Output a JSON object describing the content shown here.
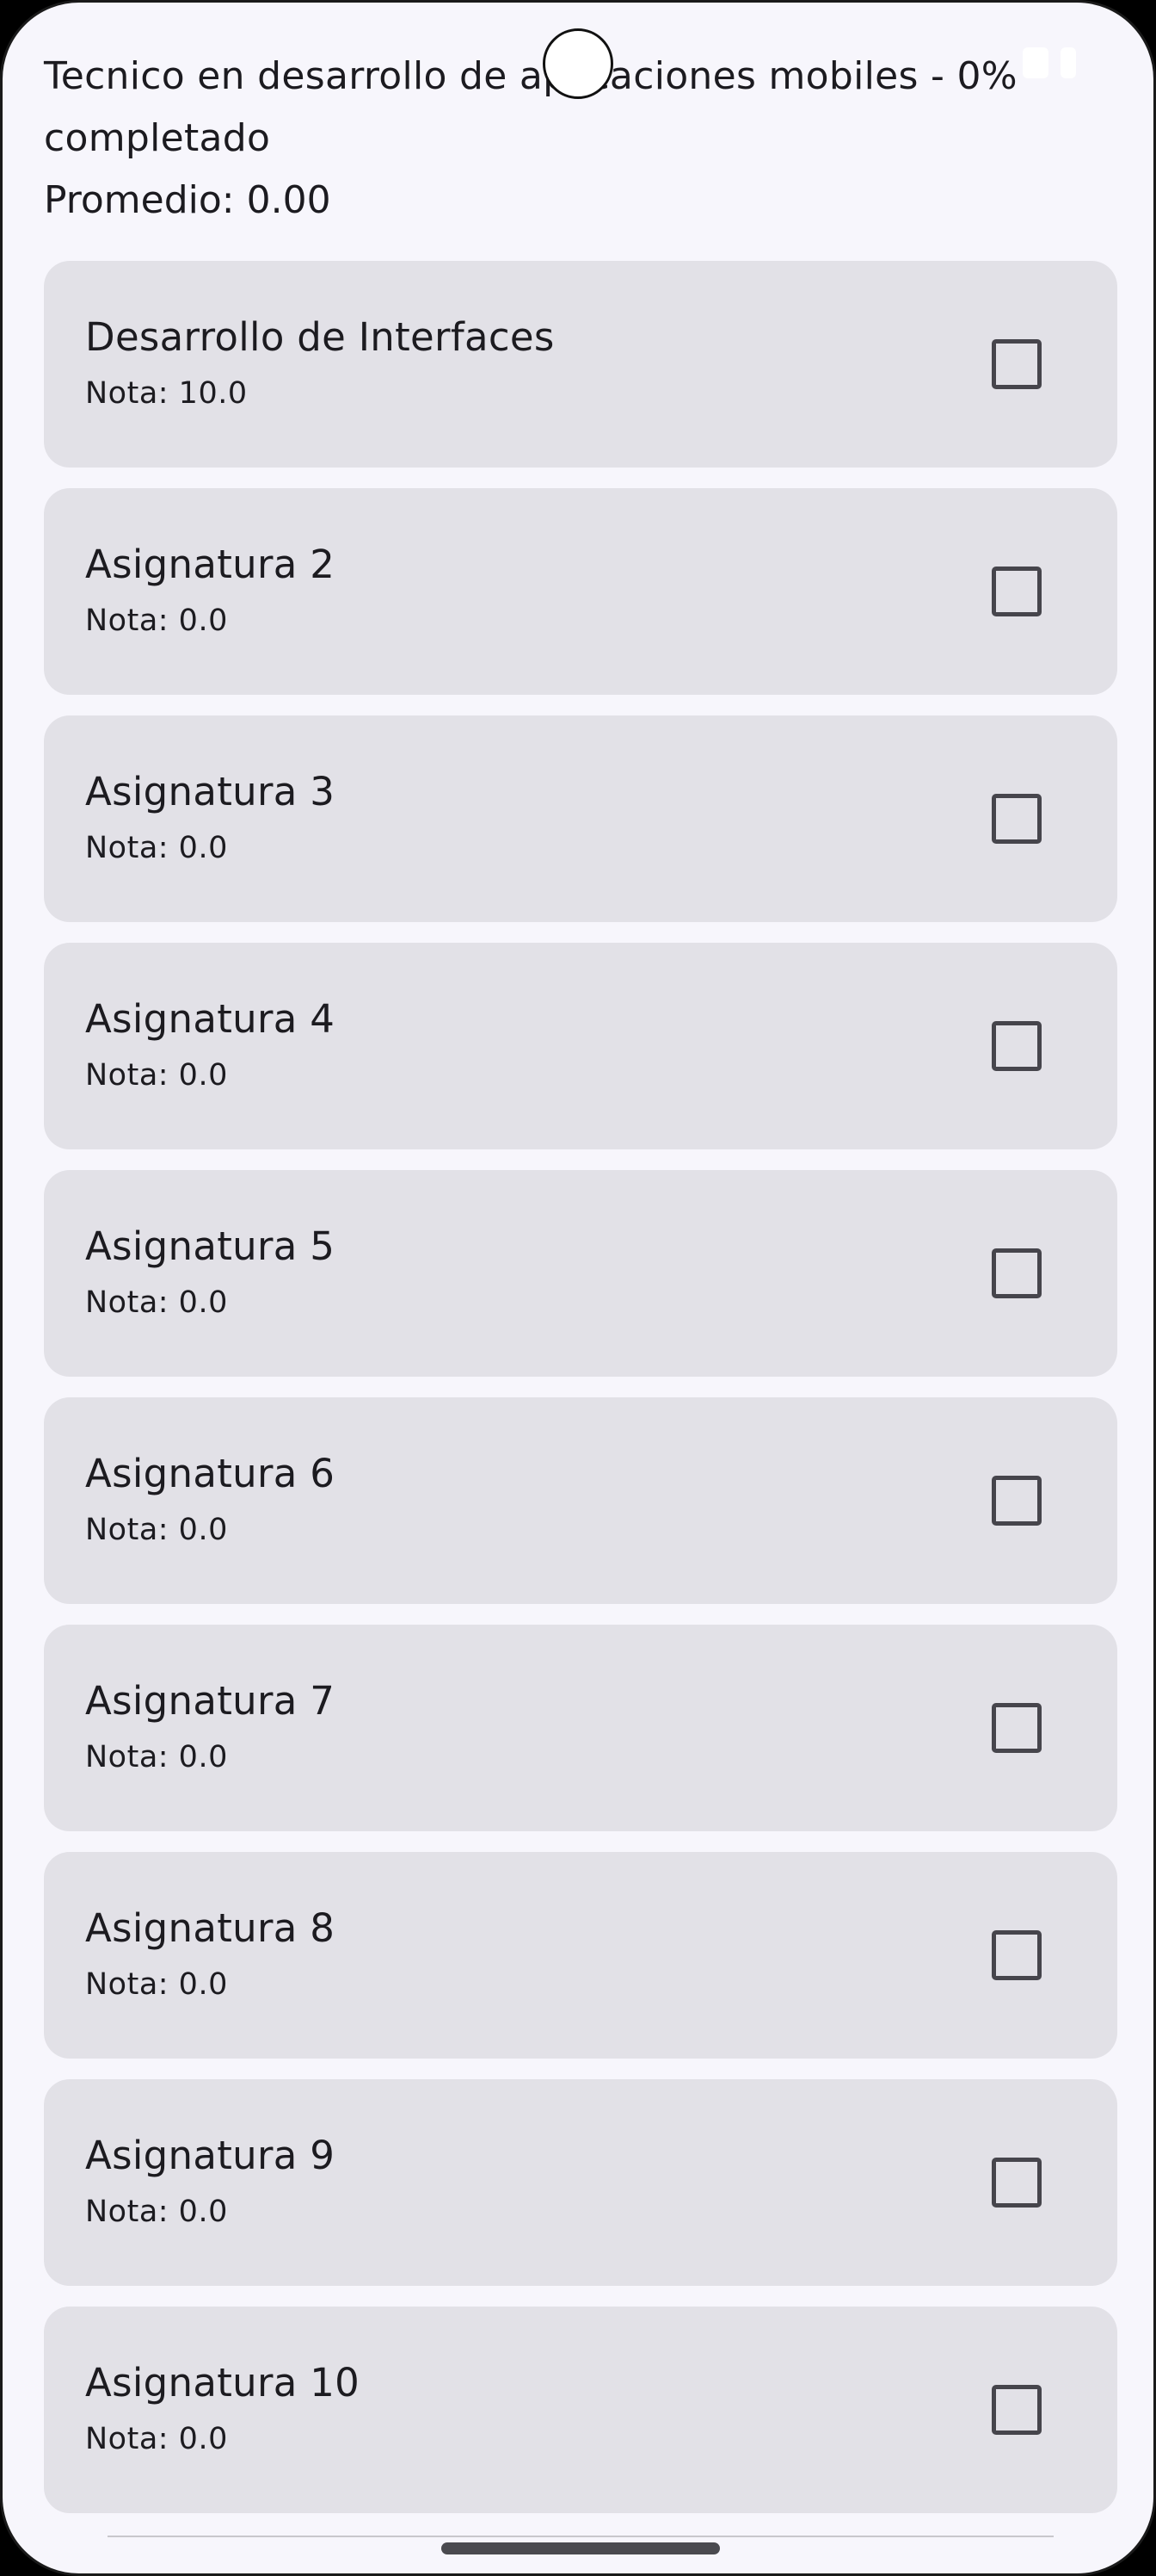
{
  "header": {
    "title": "Tecnico en desarrollo de aplicaciones mobiles  - 0% completado",
    "average": "Promedio: 0.00"
  },
  "subjects": [
    {
      "name": "Desarrollo de Interfaces",
      "grade": "Nota: 10.0",
      "checked": false
    },
    {
      "name": "Asignatura 2",
      "grade": "Nota: 0.0",
      "checked": false
    },
    {
      "name": "Asignatura 3",
      "grade": "Nota: 0.0",
      "checked": false
    },
    {
      "name": "Asignatura 4",
      "grade": "Nota: 0.0",
      "checked": false
    },
    {
      "name": "Asignatura 5",
      "grade": "Nota: 0.0",
      "checked": false
    },
    {
      "name": "Asignatura 6",
      "grade": "Nota: 0.0",
      "checked": false
    },
    {
      "name": "Asignatura 7",
      "grade": "Nota: 0.0",
      "checked": false
    },
    {
      "name": "Asignatura 8",
      "grade": "Nota: 0.0",
      "checked": false
    },
    {
      "name": "Asignatura 9",
      "grade": "Nota: 0.0",
      "checked": false
    },
    {
      "name": "Asignatura 10",
      "grade": "Nota: 0.0",
      "checked": false
    }
  ],
  "colors": {
    "background": "#f7f6fc",
    "card": "#e2e1e7",
    "text": "#1c1b20",
    "checkbox_border": "#46454c"
  }
}
